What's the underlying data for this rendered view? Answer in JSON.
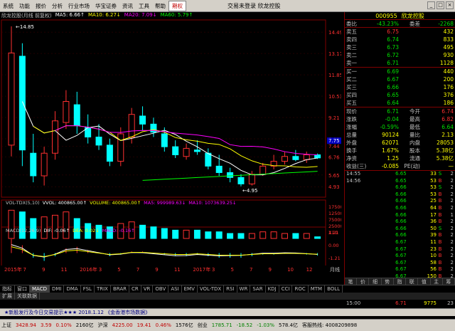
{
  "menubar": {
    "items": [
      "系统",
      "功能",
      "报价",
      "分析",
      "行业市场",
      "华宝证券",
      "资讯",
      "工具",
      "帮助",
      "期权"
    ],
    "active_index": 9,
    "title": "交易未登录  欣龙控股",
    "win_buttons": [
      "_",
      "□",
      "×"
    ]
  },
  "chart_header": {
    "title": "欣龙控股(月线 前复权)",
    "ma5": "MA5: 6.66↑",
    "ma10": "MA10: 6.27↓",
    "ma20": "MA20: 7.09↓",
    "ma60": "MA60: 5.79↑",
    "ma5_color": "#ffffff",
    "ma10_color": "#ffff00",
    "ma20_color": "#ff00ff",
    "ma60_color": "#00ff00"
  },
  "price_axis": [
    "14.49",
    "13.17",
    "11.85",
    "10.53",
    "9.21",
    "7.89",
    "7.44",
    "6.76",
    "5.65",
    "4.93"
  ],
  "price_tag": "7.75",
  "annotations": {
    "high": "14.85",
    "low": "4.95"
  },
  "vol_header": {
    "title": "VOL-TDX(5,10)",
    "vvol": "VVOL: 400865.00↑",
    "volume": "VOLUME: 400865.00↑",
    "ma5": "MA5: 999989.63↓",
    "ma10": "MA10: 1073639.25↓"
  },
  "vol_axis": [
    "175000",
    "125000",
    "75000",
    "25000",
    "X10"
  ],
  "macd_header": {
    "title": "MACD(12,26,9)",
    "dif": "DIF: -0.06↑",
    "dea": "DEA: 0.02↓",
    "macd": "MACD: -0.16↑"
  },
  "macd_axis": [
    "1.21",
    "0.00",
    "-1.21"
  ],
  "time_axis": [
    "2015年",
    "7",
    "9",
    "11",
    "2016年",
    "3",
    "5",
    "7",
    "9",
    "11",
    "2017年",
    "3",
    "5",
    "7",
    "9",
    "10",
    "12"
  ],
  "time_label": "月线",
  "bottom_tabs": [
    "指标",
    "窗口",
    "MACD",
    "DMI",
    "DMA",
    "FSL",
    "TRIX",
    "BRAR",
    "CR",
    "VR",
    "OBV",
    "ASI",
    "EMV",
    "VOL-TDX",
    "RSI",
    "WR",
    "SAR",
    "KDJ",
    "CCI",
    "ROC",
    "MTM",
    "BOLL"
  ],
  "bottom_tabs2": [
    "扩展",
    "关联数据"
  ],
  "quote": {
    "code": "000955",
    "name": "欣龙控股",
    "weibi_label": "委比",
    "weibi": "-43.23%",
    "weicha_label": "委差",
    "weicha": "-2268",
    "asks": [
      {
        "label": "卖五",
        "price": "6.75",
        "vol": "432"
      },
      {
        "label": "卖四",
        "price": "6.74",
        "vol": "833"
      },
      {
        "label": "卖三",
        "price": "6.73",
        "vol": "495"
      },
      {
        "label": "卖二",
        "price": "6.72",
        "vol": "930"
      },
      {
        "label": "卖一",
        "price": "6.71",
        "vol": "1128"
      }
    ],
    "bids": [
      {
        "label": "买一",
        "price": "6.69",
        "vol": "440"
      },
      {
        "label": "买二",
        "price": "6.67",
        "vol": "200"
      },
      {
        "label": "买三",
        "price": "6.66",
        "vol": "176"
      },
      {
        "label": "买四",
        "price": "6.65",
        "vol": "376"
      },
      {
        "label": "买五",
        "price": "6.64",
        "vol": "186"
      }
    ],
    "stats": [
      {
        "l1": "现价",
        "v1": "6.71",
        "l2": "今开",
        "v2": "6.74"
      },
      {
        "l1": "涨跌",
        "v1": "-0.04",
        "l2": "最高",
        "v2": "6.82"
      },
      {
        "l1": "涨幅",
        "v1": "-0.59%",
        "l2": "最低",
        "v2": "6.64"
      },
      {
        "l1": "总量",
        "v1": "90124",
        "l2": "量比",
        "v2": "2.13"
      },
      {
        "l1": "外盘",
        "v1": "62071",
        "l2": "内盘",
        "v2": "28053"
      },
      {
        "l1": "换手",
        "v1": "1.67%",
        "l2": "股本",
        "v2": "5.38亿"
      },
      {
        "l1": "净资",
        "v1": "1.25",
        "l2": "流通",
        "v2": "5.38亿"
      },
      {
        "l1": "收益(三)",
        "v1": "-0.085",
        "l2": "PE(动)",
        "v2": "—"
      }
    ],
    "ticks": [
      {
        "t": "14:55",
        "p": "6.65",
        "v": "33",
        "d": "S",
        "n": "2"
      },
      {
        "t": "14:56",
        "p": "6.65",
        "v": "53",
        "d": "B",
        "n": "2"
      },
      {
        "t": "",
        "p": "6.66",
        "v": "53",
        "d": "S",
        "n": "2"
      },
      {
        "t": "",
        "p": "6.66",
        "v": "53",
        "d": "B",
        "n": "2"
      },
      {
        "t": "",
        "p": "6.66",
        "v": "25",
        "d": "B",
        "n": "2"
      },
      {
        "t": "",
        "p": "6.66",
        "v": "64",
        "d": "B",
        "n": "2"
      },
      {
        "t": "",
        "p": "6.66",
        "v": "17",
        "d": "B",
        "n": "1"
      },
      {
        "t": "",
        "p": "6.66",
        "v": "36",
        "d": "B",
        "n": "2"
      },
      {
        "t": "",
        "p": "6.66",
        "v": "50",
        "d": "S",
        "n": "2"
      },
      {
        "t": "",
        "p": "6.66",
        "v": "39",
        "d": "B",
        "n": "2"
      },
      {
        "t": "",
        "p": "6.67",
        "v": "11",
        "d": "B",
        "n": "2"
      },
      {
        "t": "",
        "p": "6.67",
        "v": "23",
        "d": "B",
        "n": "2"
      },
      {
        "t": "",
        "p": "6.67",
        "v": "10",
        "d": "B",
        "n": "2"
      },
      {
        "t": "",
        "p": "6.67",
        "v": "58",
        "d": "B",
        "n": "2"
      },
      {
        "t": "",
        "p": "6.67",
        "v": "56",
        "d": "B",
        "n": "2"
      },
      {
        "t": "",
        "p": "6.67",
        "v": "150",
        "d": "B",
        "n": "2"
      },
      {
        "t": "",
        "p": "6.67",
        "v": "33",
        "d": "S",
        "n": "2"
      },
      {
        "t": "",
        "p": "6.69",
        "v": "5",
        "d": "S",
        "n": "1"
      },
      {
        "t": "",
        "p": "6.69",
        "v": "301",
        "d": "B",
        "n": "5"
      },
      {
        "t": "15:00",
        "p": "6.71",
        "v": "9775",
        "d": "",
        "n": "23"
      }
    ],
    "tabs": [
      "笔",
      "价",
      "细",
      "势",
      "指",
      "联",
      "值",
      "主",
      "筹"
    ]
  },
  "news": "★新股发行及今日交易提示★★★  2018.1.12 《金香港市场数据》",
  "status": {
    "sh_label": "上证",
    "sh_val": "3428.94",
    "sh_chg": "3.59",
    "sh_pct": "0.10%",
    "sh_amt": "2160亿",
    "sz_label": "沪深",
    "sz_val": "4225.00",
    "sz_chg": "19.41",
    "sz_pct": "0.46%",
    "sz_amt": "1576亿",
    "cy_label": "创业",
    "cy_val": "1785.71",
    "cy_chg": "-18.52",
    "cy_pct": "-1.03%",
    "cy_amt": "578.4亿",
    "hotline": "客服热线: 4008209898"
  },
  "chart_data": {
    "type": "candlestick",
    "series": "monthly",
    "ohlc": [
      [
        7.5,
        14.85,
        6.8,
        13.2
      ],
      [
        13.0,
        13.8,
        6.2,
        7.2
      ],
      [
        7.0,
        8.2,
        5.2,
        5.6
      ],
      [
        5.6,
        7.4,
        5.0,
        7.0
      ],
      [
        7.0,
        9.6,
        6.6,
        9.0
      ],
      [
        8.9,
        10.9,
        8.5,
        10.2
      ],
      [
        10.0,
        10.8,
        8.2,
        8.7
      ],
      [
        8.6,
        9.4,
        7.6,
        8.0
      ],
      [
        8.0,
        8.8,
        7.2,
        7.5
      ],
      [
        7.5,
        7.9,
        6.2,
        6.5
      ],
      [
        6.5,
        8.6,
        6.2,
        8.2
      ],
      [
        8.0,
        9.8,
        7.6,
        9.4
      ],
      [
        9.3,
        9.9,
        8.4,
        8.8
      ],
      [
        8.8,
        9.2,
        8.0,
        8.3
      ],
      [
        8.2,
        8.6,
        7.1,
        7.4
      ],
      [
        7.4,
        7.8,
        6.7,
        6.9
      ],
      [
        6.8,
        7.6,
        6.6,
        7.3
      ],
      [
        7.2,
        7.8,
        6.9,
        7.1
      ],
      [
        7.0,
        7.3,
        6.0,
        6.2
      ],
      [
        6.2,
        6.9,
        5.6,
        5.8
      ],
      [
        5.8,
        6.1,
        5.2,
        5.5
      ],
      [
        5.5,
        5.7,
        4.95,
        5.1
      ],
      [
        5.1,
        5.9,
        5.0,
        5.7
      ],
      [
        5.7,
        6.4,
        5.6,
        6.2
      ],
      [
        6.2,
        6.9,
        6.0,
        6.5
      ],
      [
        6.5,
        7.1,
        6.3,
        6.8
      ],
      [
        6.8,
        7.2,
        6.5,
        6.6
      ],
      [
        6.6,
        7.1,
        6.4,
        6.9
      ],
      [
        6.9,
        6.98,
        6.64,
        6.71
      ]
    ],
    "volume": [
      17,
      16,
      12,
      13,
      14,
      16,
      12,
      9,
      8,
      7,
      9,
      10,
      8,
      7,
      6,
      5,
      5,
      5,
      4,
      4,
      3,
      3,
      3,
      4,
      4,
      3,
      3,
      3,
      1
    ],
    "macd": [
      0.9,
      0.5,
      -0.3,
      -0.5,
      -0.2,
      0.3,
      0.4,
      0.2,
      0.0,
      -0.2,
      -0.1,
      0.1,
      0.1,
      0.0,
      -0.1,
      -0.2,
      -0.2,
      -0.1,
      -0.2,
      -0.3,
      -0.3,
      -0.3,
      -0.2,
      -0.1,
      -0.1,
      -0.05,
      -0.05,
      -0.1,
      -0.16
    ],
    "ylim": [
      4.5,
      15.2
    ]
  }
}
